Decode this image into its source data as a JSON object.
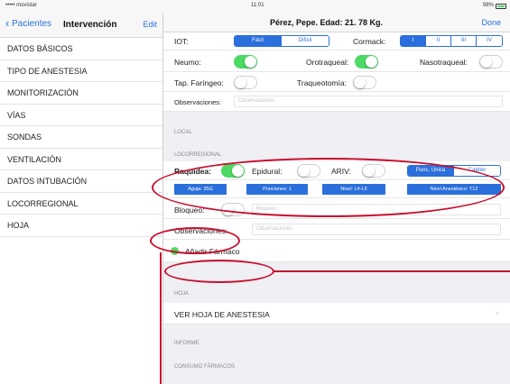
{
  "status_bar": {
    "carrier": "••••• movistar",
    "time": "11:01",
    "battery": "98%"
  },
  "sidebar": {
    "back_label": "Pacientes",
    "title": "Intervención",
    "edit_label": "Edit",
    "items": [
      {
        "label": "DATOS BÁSICOS"
      },
      {
        "label": "TIPO DE ANESTESIA"
      },
      {
        "label": "MONITORIZACIÓN"
      },
      {
        "label": "VÍAS"
      },
      {
        "label": "SONDAS"
      },
      {
        "label": "VENTILACIÓN"
      },
      {
        "label": "DATOS INTUBACIÓN"
      },
      {
        "label": "LOCORREGIONAL"
      },
      {
        "label": "HOJA"
      }
    ]
  },
  "main": {
    "title": "Pérez, Pepe. Edad: 21. 78 Kg.",
    "done_label": "Done",
    "iot": {
      "label": "IOT:",
      "options": [
        "Fácil",
        "Difícil"
      ],
      "selected": 0
    },
    "cormack": {
      "label": "Cormack:",
      "options": [
        "I",
        "II",
        "III",
        "IV"
      ],
      "selected": 0
    },
    "neumo": {
      "label": "Neumo:",
      "on": true
    },
    "orotraqueal": {
      "label": "Orotraqueal:",
      "on": true
    },
    "nasotraqueal": {
      "label": "Nasotraqueal:",
      "on": false
    },
    "tap_faringeo": {
      "label": "Tap. Faríngeo:",
      "on": false
    },
    "traqueotomia": {
      "label": "Traqueotomía:",
      "on": false
    },
    "observaciones_top": {
      "label": "Observaciones:",
      "placeholder": "Observaciones"
    },
    "section_local": "LOCAL",
    "section_locorregional": "LOCORREGIONAL",
    "raquidea": {
      "label": "Raquídea:",
      "on": true
    },
    "epidural": {
      "label": "Epidural:",
      "on": false
    },
    "arv": {
      "label": "ARIV:",
      "on": false
    },
    "punc_options": [
      "Punc. Única",
      "Catéter"
    ],
    "chips": [
      "Aguja: 25G",
      "Punciones: 1",
      "Nivel: L4-L5",
      "Nivel Anestésico: T12"
    ],
    "bloqueo": {
      "label": "Bloqueo:",
      "on": false,
      "placeholder": "Bloqueo"
    },
    "observaciones": {
      "label": "Observaciones:",
      "placeholder": "Observaciones"
    },
    "add_drug_label": "Añadir Fármaco",
    "section_hoja": "HOJA",
    "ver_hoja": "VER HOJA DE ANESTESIA",
    "section_informe": "INFORME",
    "section_consumo": "CONSUMO FÁRMACOS"
  },
  "colors": {
    "accent": "#2a6fdb",
    "toggle_on": "#4cd964",
    "annotation": "#c8102e",
    "section_bg": "#efeff4"
  }
}
